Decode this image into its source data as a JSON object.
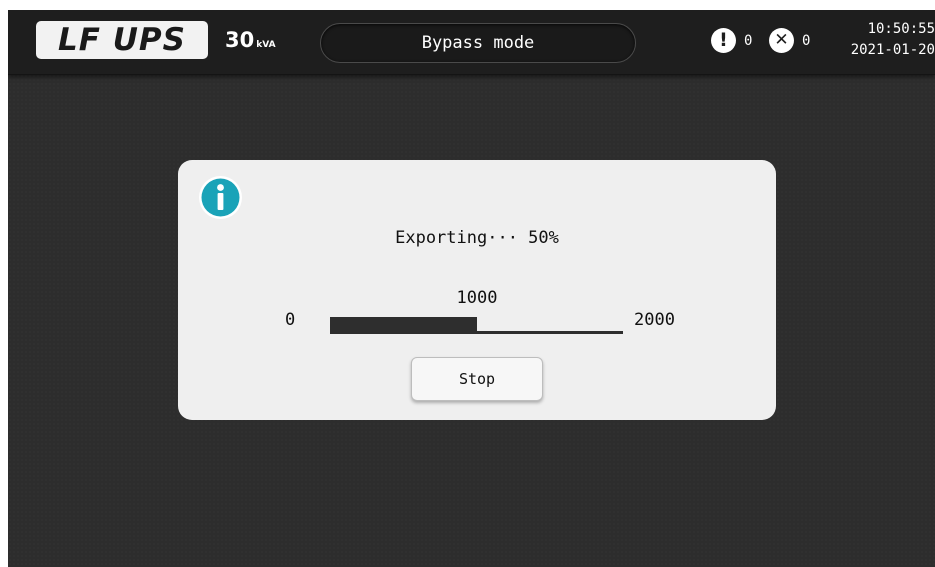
{
  "header": {
    "logo_text": "LF UPS",
    "rating_value": "30",
    "rating_unit": "kVA",
    "mode": "Bypass mode",
    "warning_count": "0",
    "fault_count": "0",
    "time": "10:50:55",
    "date": "2021-01-20"
  },
  "icons": {
    "warning": "exclamation-circle-icon",
    "fault": "x-circle-icon",
    "info": "info-icon"
  },
  "dialog": {
    "status_text": "Exporting··· 50%",
    "progress_value": 1000,
    "progress_current_label": "1000",
    "progress_min_label": "0",
    "progress_max_label": "2000",
    "progress_min": 0,
    "progress_max": 2000,
    "stop_label": "Stop"
  },
  "colors": {
    "info_accent": "#1aa3b8",
    "background": "#2d2d2d",
    "dialog_background": "#efefef"
  }
}
